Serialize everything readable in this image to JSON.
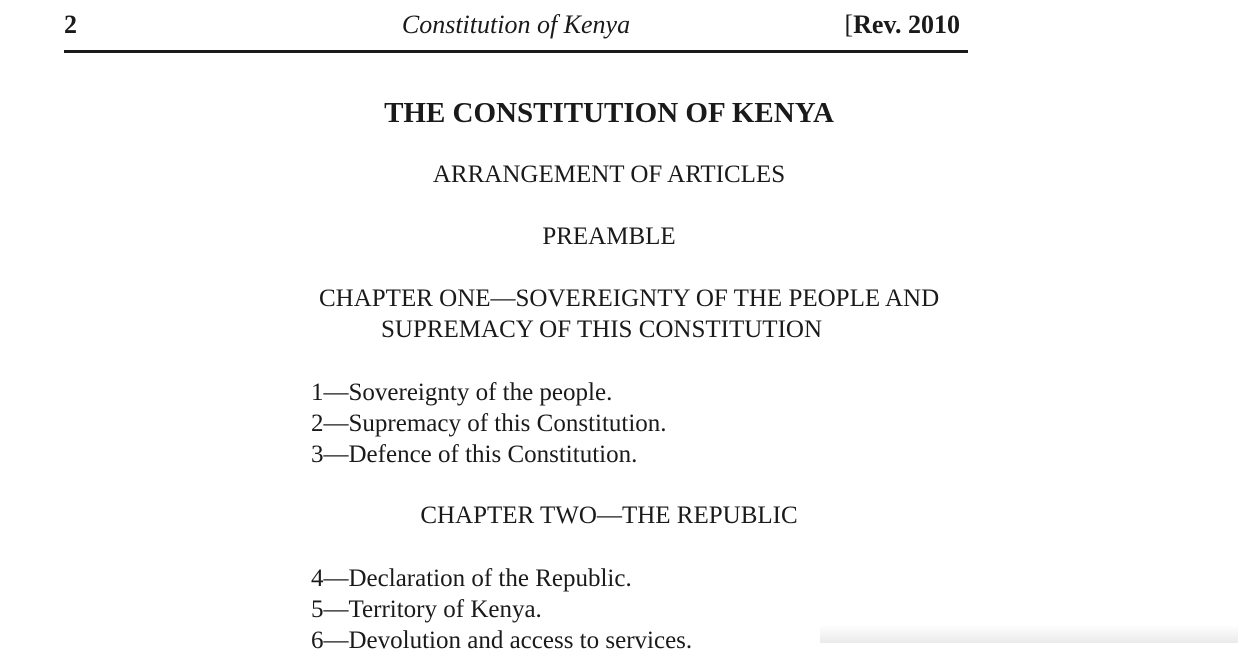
{
  "running_head": {
    "page_number": "2",
    "title": "Constitution of Kenya",
    "revision_bracket": "[",
    "revision": "Rev. 2010"
  },
  "document": {
    "title": "THE CONSTITUTION OF KENYA",
    "arrangement_heading": "ARRANGEMENT OF ARTICLES",
    "preamble_heading": "PREAMBLE",
    "chapter_one": {
      "heading_line1": "CHAPTER ONE—SOVEREIGNTY OF THE PEOPLE AND",
      "heading_line2": "SUPREMACY OF THIS CONSTITUTION",
      "articles": [
        "1—Sovereignty of the people.",
        "2—Supremacy of this Constitution.",
        "3—Defence of this Constitution."
      ]
    },
    "chapter_two": {
      "heading": "CHAPTER TWO—THE REPUBLIC",
      "articles": [
        "4—Declaration of the Republic.",
        "5—Territory of Kenya.",
        "6—Devolution and access to services."
      ]
    }
  }
}
